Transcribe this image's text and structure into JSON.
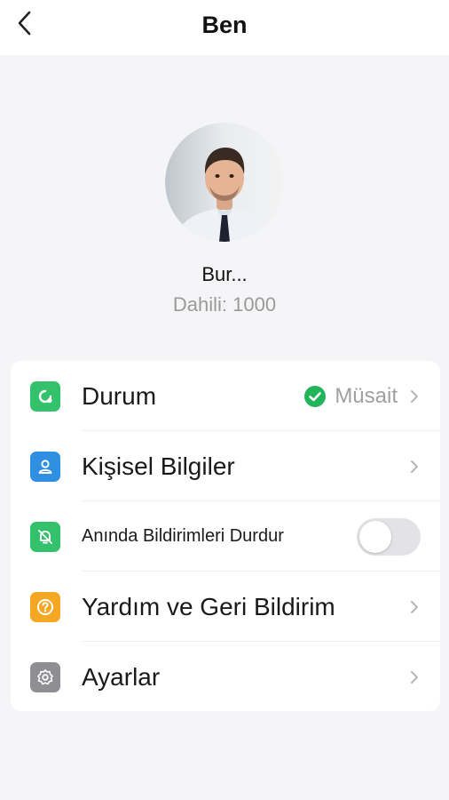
{
  "header": {
    "title": "Ben"
  },
  "profile": {
    "name": "Bur...",
    "extension": "Dahili: 1000"
  },
  "menu": {
    "items": [
      {
        "label": "Durum",
        "icon": "status-refresh-icon",
        "icon_color": "#33c26b",
        "value": "Müsait",
        "value_icon_color": "#22b45a"
      },
      {
        "label": "Kişisel Bilgiler",
        "icon": "person-icon",
        "icon_color": "#2f8fe0"
      },
      {
        "label": "Anında Bildirimleri Durdur",
        "icon": "bell-off-icon",
        "icon_color": "#33c26b",
        "toggle_on": false
      },
      {
        "label": "Yardım ve Geri Bildirim",
        "icon": "help-icon",
        "icon_color": "#f5a623"
      },
      {
        "label": "Ayarlar",
        "icon": "gear-icon",
        "icon_color": "#8e8e93"
      }
    ]
  }
}
